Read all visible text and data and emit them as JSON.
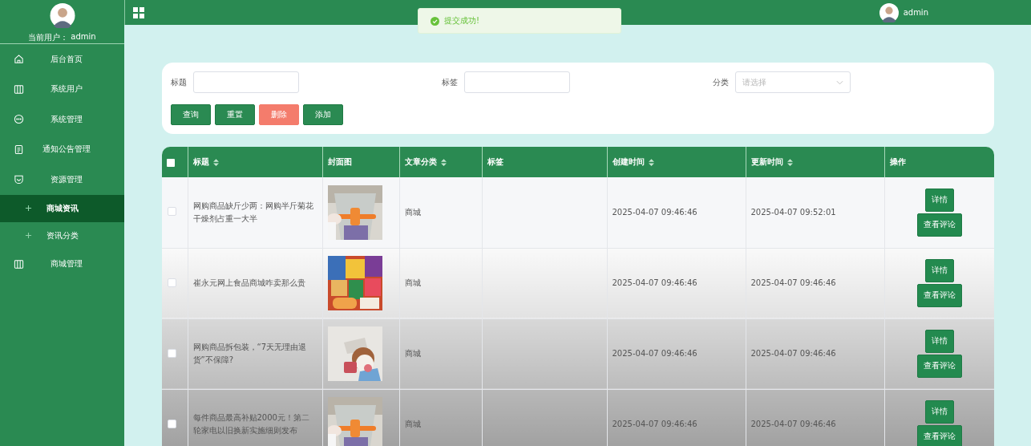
{
  "sidebar": {
    "user_label": "当前用户：",
    "user_name": "admin",
    "items": [
      {
        "label": "后台首页",
        "selected": false
      },
      {
        "label": "系统用户",
        "selected": false
      },
      {
        "label": "系统管理",
        "selected": false
      },
      {
        "label": "通知公告管理",
        "selected": false
      },
      {
        "label": "资源管理",
        "selected": false,
        "children": [
          {
            "label": "商城资讯",
            "selected": true
          },
          {
            "label": "资讯分类",
            "selected": false
          }
        ]
      },
      {
        "label": "商城管理",
        "selected": false
      }
    ]
  },
  "header": {
    "user_name": "admin"
  },
  "toast": {
    "message": "提交成功!"
  },
  "filters": [
    {
      "label": "标题",
      "kind": "input"
    },
    {
      "label": "标签",
      "kind": "input"
    },
    {
      "label": "分类",
      "kind": "select",
      "placeholder": "请选择"
    }
  ],
  "buttons": [
    {
      "label": "查询",
      "kind": "primary"
    },
    {
      "label": "重置",
      "kind": "primary"
    },
    {
      "label": "删除",
      "kind": "danger"
    },
    {
      "label": "添加",
      "kind": "primary"
    }
  ],
  "table": {
    "select_all": {
      "checked": false
    },
    "columns": [
      {
        "label": "标题",
        "sortable": true
      },
      {
        "label": "封面图",
        "sortable": false
      },
      {
        "label": "文章分类",
        "sortable": true
      },
      {
        "label": "标签",
        "sortable": false
      },
      {
        "label": "创建时间",
        "sortable": true
      },
      {
        "label": "更新时间",
        "sortable": true
      },
      {
        "label": "操作",
        "sortable": false
      }
    ],
    "rows": [
      {
        "checked": false,
        "title": "网购商品缺斤少两：网购半斤菊花干燥剂占重一大半",
        "cover": {
          "kind": "picture"
        },
        "category": "商城",
        "created": "2025-04-07 09:46:46",
        "updated": "2025-04-07 09:52:01",
        "actions": [
          "详情",
          "查看评论"
        ]
      },
      {
        "checked": false,
        "title": "崔永元网上食品商城咋卖那么贵",
        "cover": {
          "kind": "picture"
        },
        "category": "商城",
        "created": "2025-04-07 09:46:46",
        "updated": "2025-04-07 09:46:46",
        "actions": [
          "详情",
          "查看评论"
        ]
      },
      {
        "checked": false,
        "title": "网购商品拆包装，“7天无理由退货”不保障?",
        "cover": {
          "kind": "picture"
        },
        "category": "商城",
        "created": "2025-04-07 09:46:46",
        "updated": "2025-04-07 09:46:46",
        "actions": [
          "详情",
          "查看评论"
        ]
      },
      {
        "checked": false,
        "title": "每件商品最高补贴2000元！第二轮家电以旧换新实施细则发布",
        "cover": {
          "kind": "picture"
        },
        "category": "商城",
        "created": "2025-04-07 09:46:46",
        "updated": "2025-04-07 09:46:46",
        "actions": [
          "详情",
          "查看评论"
        ]
      }
    ]
  }
}
